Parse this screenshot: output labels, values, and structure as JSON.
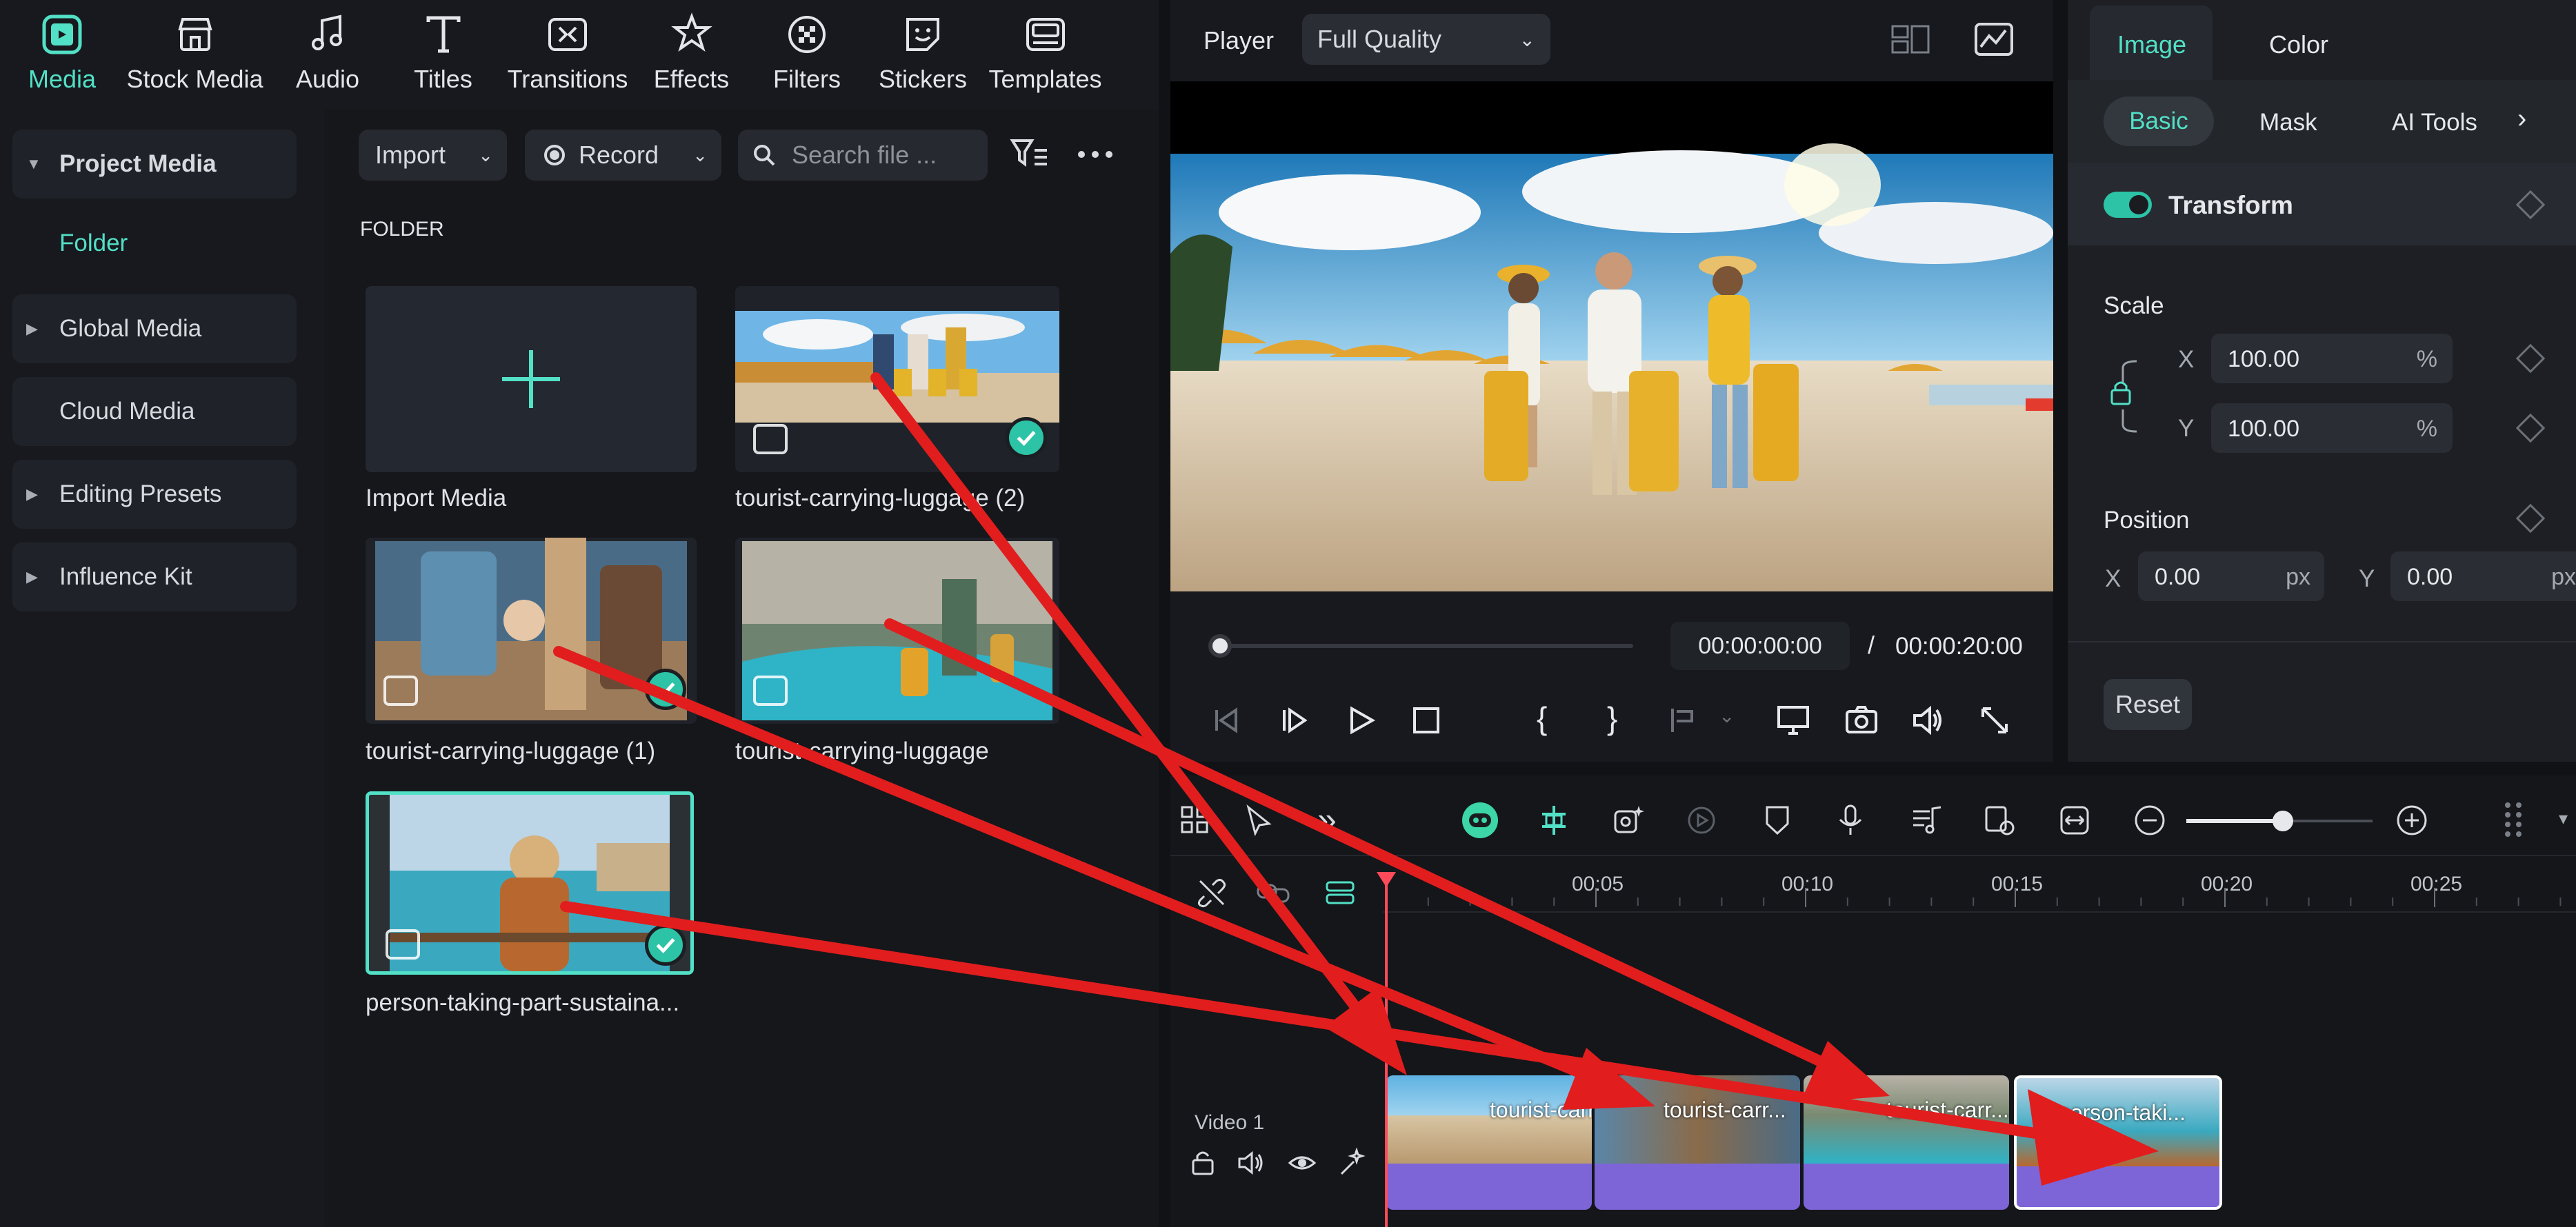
{
  "nav": {
    "items": [
      {
        "label": "Media",
        "icon": "media-icon",
        "active": true
      },
      {
        "label": "Stock Media",
        "icon": "stock-media-icon"
      },
      {
        "label": "Audio",
        "icon": "audio-icon"
      },
      {
        "label": "Titles",
        "icon": "titles-icon"
      },
      {
        "label": "Transitions",
        "icon": "transitions-icon"
      },
      {
        "label": "Effects",
        "icon": "effects-icon"
      },
      {
        "label": "Filters",
        "icon": "filters-icon"
      },
      {
        "label": "Stickers",
        "icon": "stickers-icon"
      },
      {
        "label": "Templates",
        "icon": "templates-icon"
      }
    ],
    "active_color": "#52e0c6"
  },
  "sidebar": {
    "project_media": "Project Media",
    "folder": "Folder",
    "global_media": "Global Media",
    "cloud_media": "Cloud Media",
    "editing_presets": "Editing Presets",
    "influence_kit": "Influence Kit"
  },
  "media": {
    "import_label": "Import",
    "record_label": "Record",
    "search_placeholder": "Search file ...",
    "folder_heading": "FOLDER",
    "import_media_label": "Import Media",
    "items": [
      {
        "name": "tourist-carrying-luggage (2)",
        "checked": true
      },
      {
        "name": "tourist-carrying-luggage (1)",
        "checked": true
      },
      {
        "name": "tourist-carrying-luggage",
        "checked": false
      },
      {
        "name": "person-taking-part-sustaina...",
        "checked": true,
        "selected": true
      }
    ]
  },
  "player": {
    "label": "Player",
    "quality": "Full Quality",
    "current_time": "00:00:00:00",
    "separator": "/",
    "total_time": "00:00:20:00",
    "progress": 0
  },
  "properties": {
    "tabs": [
      "Image",
      "Color"
    ],
    "active_tab": "Image",
    "subtabs": [
      "Basic",
      "Mask",
      "AI Tools"
    ],
    "active_subtab": "Basic",
    "transform_label": "Transform",
    "transform_enabled": true,
    "scale_label": "Scale",
    "scale_x_axis": "X",
    "scale_x": "100.00",
    "scale_y_axis": "Y",
    "scale_y": "100.00",
    "percent": "%",
    "position_label": "Position",
    "pos_x_axis": "X",
    "pos_x": "0.00",
    "pos_y_axis": "Y",
    "pos_y": "0.00",
    "px": "px",
    "reset_label": "Reset"
  },
  "timeline": {
    "ruler": [
      "00:05",
      "00:10",
      "00:15",
      "00:20",
      "00:25"
    ],
    "track_label": "Video 1",
    "zoom_level": 0.5,
    "clips": [
      {
        "title": "tourist-carr..."
      },
      {
        "title": "tourist-carr..."
      },
      {
        "title": "tourist-carr..."
      },
      {
        "title": "person-taki..."
      }
    ],
    "clip_color": "#7d65d8",
    "playhead_color": "#ff4a5a"
  },
  "annotation_color": "#e11d1d"
}
